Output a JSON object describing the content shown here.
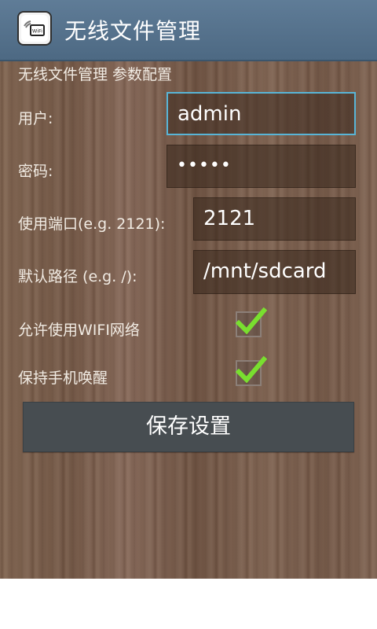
{
  "app_bar": {
    "title": "无线文件管理",
    "icon": "wifi-file-app-icon",
    "icon_text": "WiFi"
  },
  "form": {
    "section_title": "无线文件管理 参数配置",
    "user": {
      "label": "用户:",
      "value": "admin"
    },
    "password": {
      "label": "密码:",
      "value": "•••••"
    },
    "port": {
      "label": "使用端口(e.g. 2121):",
      "value": "2121"
    },
    "path": {
      "label": "默认路径 (e.g. /):",
      "value": "/mnt/sdcard"
    },
    "allow_wifi": {
      "label": "允许使用WIFI网络",
      "checked": true
    },
    "keep_awake": {
      "label": "保持手机唤醒",
      "checked": true
    },
    "save_label": "保存设置"
  },
  "colors": {
    "action_bar": "#56728d",
    "focus_border": "#58b5d7",
    "check": "#79df2f",
    "button": "#474d51"
  }
}
